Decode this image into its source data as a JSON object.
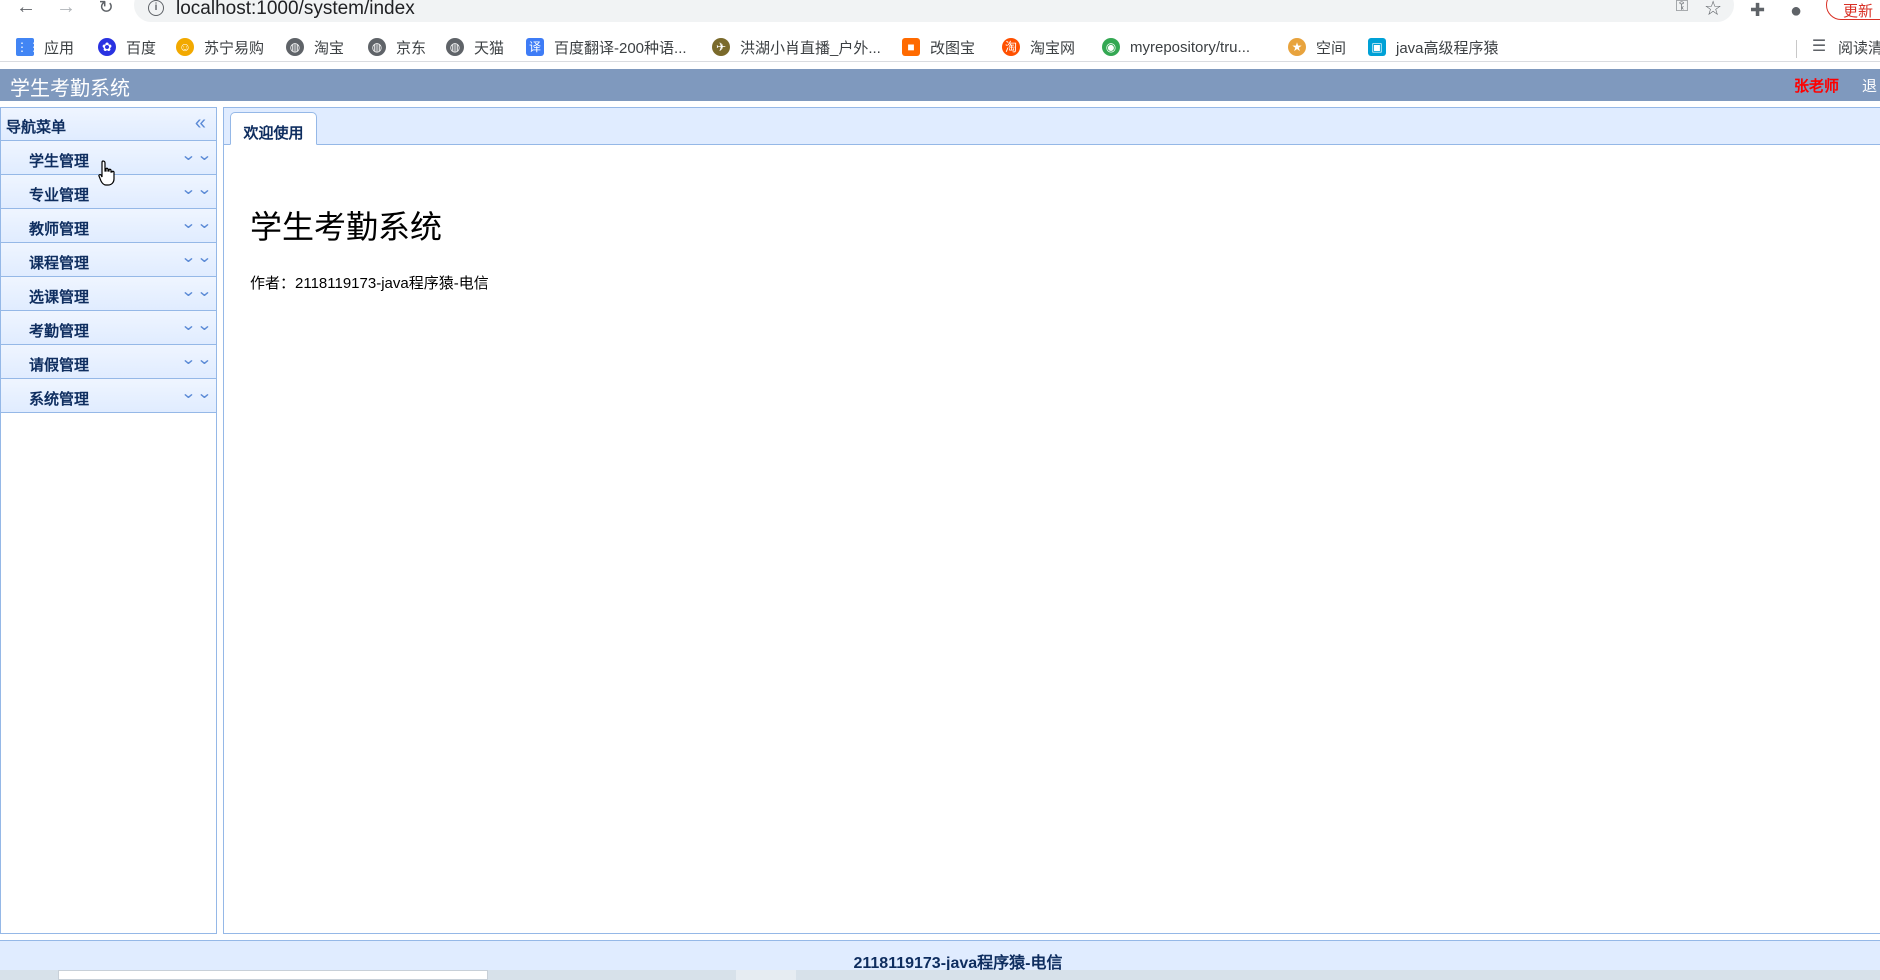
{
  "browser": {
    "url": "localhost:1000/system/index",
    "update_label": "更新",
    "reading_list_label": "阅读清单",
    "bookmarks": [
      {
        "label": "应用",
        "icon": "apps-grid-icon",
        "color": "#4285f4"
      },
      {
        "label": "百度",
        "icon": "baidu-paw-icon",
        "color": "#2932e1"
      },
      {
        "label": "苏宁易购",
        "icon": "suning-lion-icon",
        "color": "#f2a900"
      },
      {
        "label": "淘宝",
        "icon": "globe-icon",
        "color": "#5f6368"
      },
      {
        "label": "京东",
        "icon": "globe-icon",
        "color": "#5f6368"
      },
      {
        "label": "天猫",
        "icon": "globe-icon",
        "color": "#5f6368"
      },
      {
        "label": "百度翻译-200种语...",
        "icon": "translate-icon",
        "color": "#3e7cf6"
      },
      {
        "label": "洪湖小肖直播_户外...",
        "icon": "bird-icon",
        "color": "#7a6a2b"
      },
      {
        "label": "改图宝",
        "icon": "gaitubao-icon",
        "color": "#ff6a00"
      },
      {
        "label": "淘宝网",
        "icon": "taobao-icon",
        "color": "#ff5000"
      },
      {
        "label": "myrepository/tru...",
        "icon": "chrome-icon",
        "color": "#34a853"
      },
      {
        "label": "空间",
        "icon": "qzone-icon",
        "color": "#e8a33d"
      },
      {
        "label": "java高级程序猿",
        "icon": "bilibili-icon",
        "color": "#00a1d6"
      }
    ]
  },
  "header": {
    "title": "学生考勤系统",
    "user": "张老师",
    "logout": "退"
  },
  "sidebar": {
    "title": "导航菜单",
    "items": [
      {
        "label": "学生管理"
      },
      {
        "label": "专业管理"
      },
      {
        "label": "教师管理"
      },
      {
        "label": "课程管理"
      },
      {
        "label": "选课管理"
      },
      {
        "label": "考勤管理"
      },
      {
        "label": "请假管理"
      },
      {
        "label": "系统管理"
      }
    ]
  },
  "main": {
    "tab_label": "欢迎使用",
    "welcome_title": "学生考勤系统",
    "author": "作者：2118119173-java程序猿-电信"
  },
  "footer": {
    "text": "2118119173-java程序猿-电信"
  },
  "colors": {
    "header_bg": "#7f99be",
    "panel_border": "#95b8e7",
    "panel_header_bg": "#e0ecff",
    "user_name": "#ff0000"
  }
}
